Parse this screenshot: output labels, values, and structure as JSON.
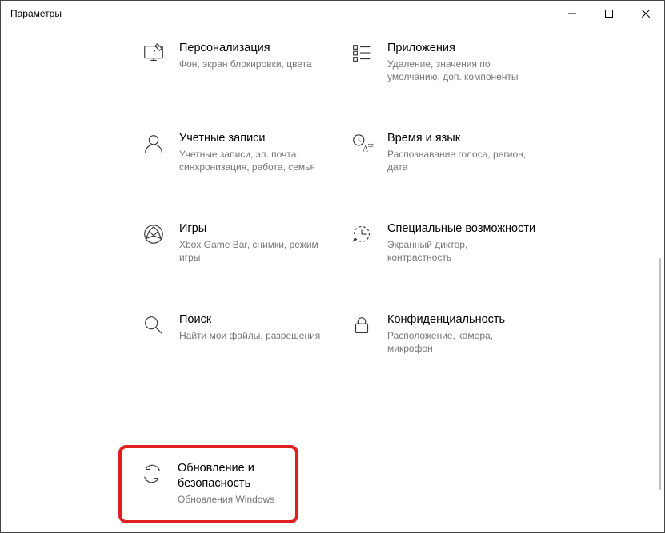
{
  "window": {
    "title": "Параметры"
  },
  "tiles": {
    "personalization": {
      "title": "Персонализация",
      "subtitle": "Фон, экран блокировки, цвета"
    },
    "apps": {
      "title": "Приложения",
      "subtitle": "Удаление, значения по умолчанию, доп. компоненты"
    },
    "accounts": {
      "title": "Учетные записи",
      "subtitle": "Учетные записи, эл. почта, синхронизация, работа, семья"
    },
    "time_language": {
      "title": "Время и язык",
      "subtitle": "Распознавание голоса, регион, дата"
    },
    "gaming": {
      "title": "Игры",
      "subtitle": "Xbox Game Bar, снимки, режим игры"
    },
    "accessibility": {
      "title": "Специальные возможности",
      "subtitle": "Экранный диктор, контрастность"
    },
    "search": {
      "title": "Поиск",
      "subtitle": "Найти мои файлы, разрешения"
    },
    "privacy": {
      "title": "Конфиденциальность",
      "subtitle": "Расположение, камера, микрофон"
    },
    "update_security": {
      "title": "Обновление и безопасность",
      "subtitle": "Обновления Windows"
    }
  }
}
